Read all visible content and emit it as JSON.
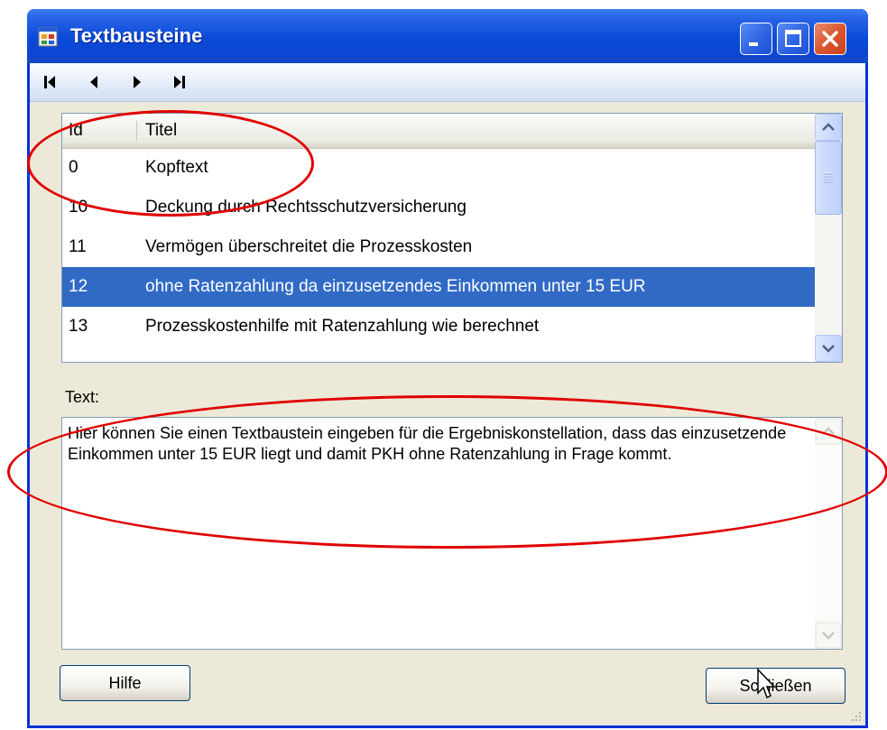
{
  "window": {
    "title": "Textbausteine",
    "controls": {
      "minimize": "minimize-icon",
      "maximize": "maximize-icon",
      "close": "close-icon"
    }
  },
  "navigator": {
    "buttons": [
      {
        "name": "first",
        "icon": "first-record-icon"
      },
      {
        "name": "previous",
        "icon": "previous-record-icon"
      },
      {
        "name": "next",
        "icon": "next-record-icon"
      },
      {
        "name": "last",
        "icon": "last-record-icon"
      }
    ]
  },
  "list": {
    "columns": [
      "Id",
      "Titel"
    ],
    "rows": [
      {
        "id": "0",
        "title": "Kopftext"
      },
      {
        "id": "10",
        "title": "Deckung durch Rechtsschutzversicherung"
      },
      {
        "id": "11",
        "title": "Vermögen überschreitet die Prozesskosten"
      },
      {
        "id": "12",
        "title": "ohne Ratenzahlung da einzusetzendes Einkommen unter 15 EUR",
        "selected": true
      },
      {
        "id": "13",
        "title": "Prozesskostenhilfe mit Ratenzahlung wie berechnet"
      }
    ]
  },
  "text_section": {
    "label": "Text:",
    "value": "Hier können Sie einen Textbaustein eingeben für die Ergebniskonstellation, dass das einzusetzende Einkommen unter 15 EUR liegt und damit PKH ohne Ratenzahlung in Frage kommt."
  },
  "buttons": {
    "help": "Hilfe",
    "close": "Schließen"
  },
  "colors": {
    "selection": "#316ac5",
    "titlebar": "#0a4ad8",
    "annotation": "#e00000",
    "window_bg": "#ece9d8"
  }
}
